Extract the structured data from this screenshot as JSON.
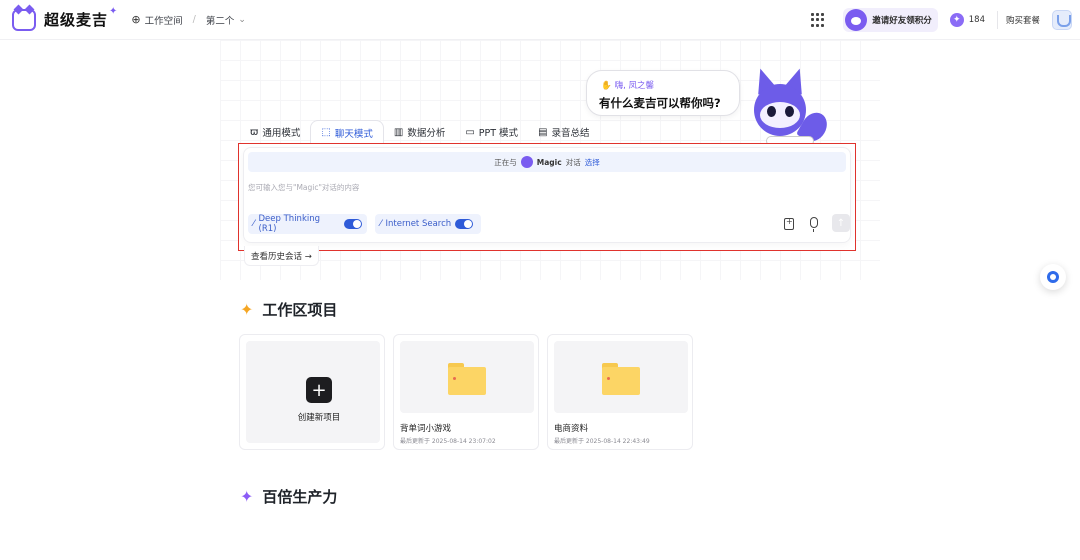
{
  "header": {
    "logo_text": "超级麦吉",
    "workspace_label": "工作空间",
    "project_label": "第二个",
    "invite_label": "邀请好友领积分",
    "points": "184",
    "buy_label": "购买套餐"
  },
  "greeting": {
    "hello": "嗨, 凤之馨",
    "question": "有什么麦吉可以帮你吗?"
  },
  "tabs": [
    {
      "label": "通用模式",
      "icon": "ϖ"
    },
    {
      "label": "聊天模式",
      "icon": "⬚"
    },
    {
      "label": "数据分析",
      "icon": "▥"
    },
    {
      "label": "PPT 模式",
      "icon": "▭"
    },
    {
      "label": "录音总结",
      "icon": "▤"
    }
  ],
  "chat": {
    "talking_prefix": "正在与",
    "agent_name": "Magic",
    "talking_suffix": "对话",
    "choose_label": "选择",
    "placeholder": "您可输入您与\"Magic\"对话的内容",
    "deep_thinking_label": "Deep Thinking (R1)",
    "internet_search_label": "Internet Search",
    "history_label": "查看历史会话 →"
  },
  "sections": {
    "workspace_title": "工作区项目",
    "productivity_title": "百倍生产力"
  },
  "cards": {
    "new_label": "创建新项目",
    "items": [
      {
        "name": "背单词小游戏",
        "time": "最后更新于 2025-08-14 23:07:02"
      },
      {
        "name": "电商资料",
        "time": "最后更新于 2025-08-14 22:43:49"
      }
    ]
  },
  "colors": {
    "accent": "#2f5bd8",
    "brand": "#7a5cf0",
    "highlight_border": "#e0332d"
  }
}
